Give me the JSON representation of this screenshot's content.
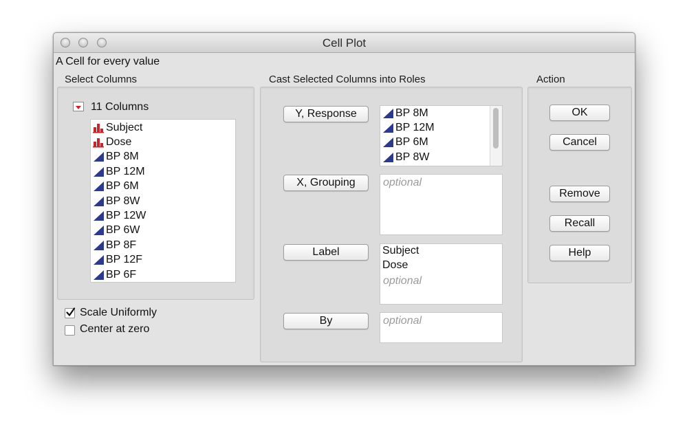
{
  "window": {
    "title": "Cell Plot",
    "subtitle": "A Cell for every value"
  },
  "select_columns": {
    "label": "Select Columns",
    "count_label": "11 Columns",
    "columns": [
      {
        "label": "Subject",
        "icon": "nominal-bar-icon"
      },
      {
        "label": "Dose",
        "icon": "nominal-bar-icon"
      },
      {
        "label": "BP 8M",
        "icon": "continuous-triangle-icon"
      },
      {
        "label": "BP 12M",
        "icon": "continuous-triangle-icon"
      },
      {
        "label": "BP 6M",
        "icon": "continuous-triangle-icon"
      },
      {
        "label": "BP 8W",
        "icon": "continuous-triangle-icon"
      },
      {
        "label": "BP 12W",
        "icon": "continuous-triangle-icon"
      },
      {
        "label": "BP 6W",
        "icon": "continuous-triangle-icon"
      },
      {
        "label": "BP 8F",
        "icon": "continuous-triangle-icon"
      },
      {
        "label": "BP 12F",
        "icon": "continuous-triangle-icon"
      },
      {
        "label": "BP 6F",
        "icon": "continuous-triangle-icon"
      }
    ]
  },
  "options": {
    "scale_uniformly": {
      "label": "Scale Uniformly",
      "checked": true
    },
    "center_at_zero": {
      "label": "Center at zero",
      "checked": false
    }
  },
  "roles": {
    "label": "Cast Selected Columns into Roles",
    "y_response": {
      "button": "Y, Response",
      "items": [
        "BP 8M",
        "BP 12M",
        "BP 6M",
        "BP 8W"
      ]
    },
    "x_grouping": {
      "button": "X, Grouping",
      "placeholder": "optional"
    },
    "label_role": {
      "button": "Label",
      "items": [
        "Subject",
        "Dose"
      ],
      "placeholder": "optional"
    },
    "by": {
      "button": "By",
      "placeholder": "optional"
    }
  },
  "action": {
    "label": "Action",
    "ok": "OK",
    "cancel": "Cancel",
    "remove": "Remove",
    "recall": "Recall",
    "help": "Help"
  },
  "colors": {
    "nominal_icon": "#c8242b",
    "continuous_icon": "#2b3a8f",
    "disclosure_red": "#d0202a"
  }
}
